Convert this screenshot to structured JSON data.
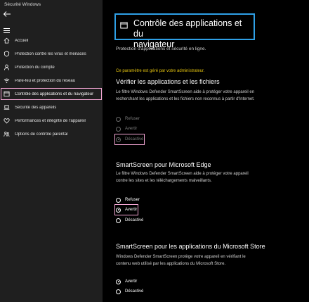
{
  "app": {
    "title": "Sécurité Windows"
  },
  "sidebar": {
    "items": [
      {
        "label": "Accueil",
        "icon": "home-icon"
      },
      {
        "label": "Protection contre les virus et menaces",
        "icon": "shield-icon"
      },
      {
        "label": "Protection du compte",
        "icon": "person-icon"
      },
      {
        "label": "Pare-feu et protection du réseau",
        "icon": "wifi-icon"
      },
      {
        "label": "Contrôle des applications et du navigateur",
        "icon": "browser-icon",
        "active": true
      },
      {
        "label": "Sécurité des appareils",
        "icon": "laptop-icon"
      },
      {
        "label": "Performances et intégrité de l'appareil",
        "icon": "heart-icon"
      },
      {
        "label": "Options de contrôle parental",
        "icon": "family-icon"
      }
    ]
  },
  "main": {
    "title_line1": "Contrôle des applications et du",
    "title_line2": "navigateur",
    "subtitle": "Protection d'applications et sécurité en ligne.",
    "admin_note": "Ce paramètre est géré par votre administrateur.",
    "sections": [
      {
        "title": "Vérifier les applications et les fichiers",
        "desc_lines": [
          "Le filtre Windows Defender SmartScreen aide à protéger votre appareil en",
          "recherchant les applications et les fichiers non reconnus à partir d'Internet."
        ],
        "options": [
          "Refuser",
          "Avertir",
          "Désactivé"
        ],
        "selected": "Désactivé",
        "disabled": true
      },
      {
        "title": "SmartScreen pour Microsoft Edge",
        "desc_lines": [
          "Le filtre Windows Defender SmartScreen aide à protéger votre appareil",
          "contre les sites et les téléchargements malveillants."
        ],
        "options": [
          "Refuser",
          "Avertir",
          "Désactivé"
        ],
        "selected": "Avertir",
        "disabled": false
      },
      {
        "title": "SmartScreen pour les applications du Microsoft Store",
        "desc_lines": [
          "Windows Defender SmartScreen protège votre appareil en vérifiant le",
          "contenu web utilisé par les applications du Microsoft Store."
        ],
        "options": [
          "Avertir",
          "Désactivé"
        ],
        "selected": "Avertir",
        "disabled": false
      }
    ]
  },
  "colors": {
    "accent_blue": "#2fa0e6",
    "highlight_pink": "#f4a6d4",
    "admin_yellow": "#e3c20f",
    "sidebar_bg": "#1f1f1f"
  }
}
